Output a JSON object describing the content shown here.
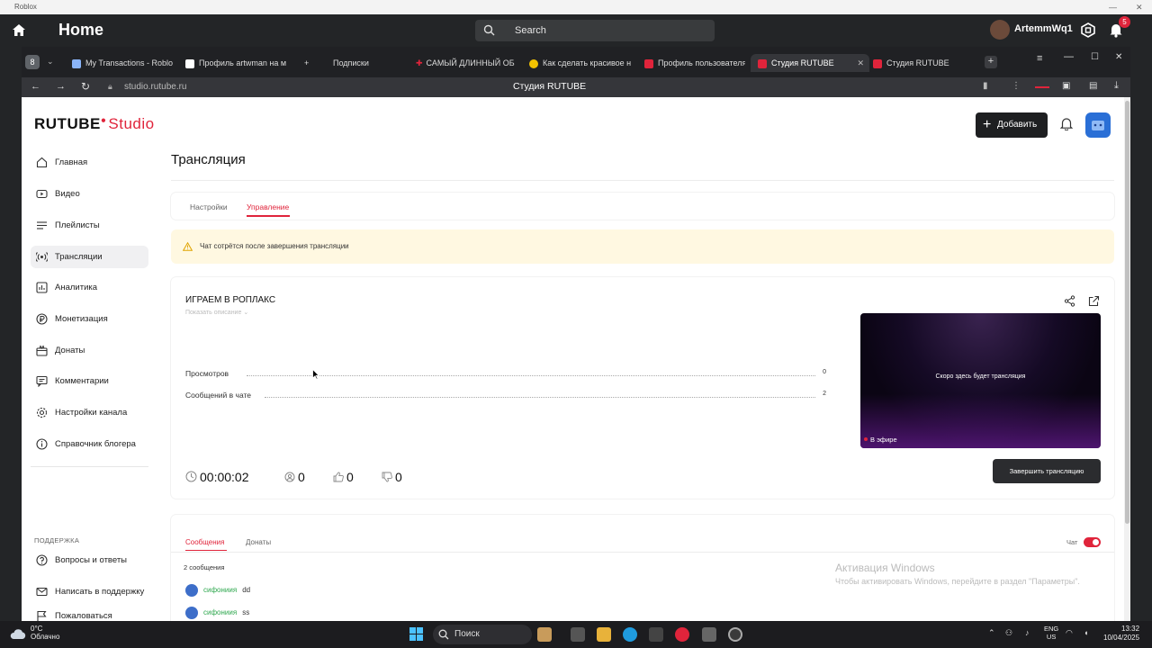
{
  "roblox": {
    "titlebar": "Roblox",
    "home_title": "Home",
    "search_placeholder": "Search",
    "username": "ArtemmWq1",
    "notification_count": "5"
  },
  "browser": {
    "tab_count": "8",
    "tabs": [
      {
        "label": "My Transactions - Roblox",
        "color": "#8ab4f8"
      },
      {
        "label": "Профиль artwman на м",
        "color": "#1f1f1f"
      },
      {
        "label": "Подписки",
        "color": "#e0243b"
      },
      {
        "label": "САМЫЙ ДЛИННЫЙ ОБ",
        "color": "#e0243b"
      },
      {
        "label": "Как сделать красивое н",
        "color": "#f2c200"
      },
      {
        "label": "Профиль пользователя",
        "color": "#e0243b"
      },
      {
        "label": "Студия RUTUBE",
        "color": "#e0243b"
      },
      {
        "label": "Студия RUTUBE",
        "color": "#e0243b"
      }
    ],
    "url": "studio.rutube.ru",
    "page_title": "Студия RUTUBE"
  },
  "studio": {
    "logo_main": "RUTUBE",
    "logo_studio": "Studio",
    "add_label": "Добавить",
    "nav": [
      {
        "label": "Главная",
        "icon": "home-icon"
      },
      {
        "label": "Видео",
        "icon": "video-icon"
      },
      {
        "label": "Плейлисты",
        "icon": "playlist-icon"
      },
      {
        "label": "Трансляции",
        "icon": "broadcast-icon"
      },
      {
        "label": "Аналитика",
        "icon": "analytics-icon"
      },
      {
        "label": "Монетизация",
        "icon": "ruble-icon"
      },
      {
        "label": "Донаты",
        "icon": "gift-icon"
      },
      {
        "label": "Комментарии",
        "icon": "comment-icon"
      },
      {
        "label": "Настройки канала",
        "icon": "gear-icon"
      },
      {
        "label": "Справочник блогера",
        "icon": "info-icon"
      }
    ],
    "support_heading": "ПОДДЕРЖКА",
    "support": [
      {
        "label": "Вопросы и ответы",
        "icon": "help-icon"
      },
      {
        "label": "Написать в поддержку",
        "icon": "mail-icon"
      },
      {
        "label": "Пожаловаться",
        "icon": "flag-icon"
      }
    ],
    "page_title": "Трансляция",
    "tabs": {
      "settings": "Настройки",
      "manage": "Управление"
    },
    "warning": "Чат сотрётся после завершения трансляции",
    "stream": {
      "title": "ИГРАЕМ В РОПЛАКС",
      "show_description": "Показать описание",
      "views_label": "Просмотров",
      "views_value": "0",
      "messages_label": "Сообщений в чате",
      "messages_value": "2",
      "timer": "00:00:02",
      "viewers": "0",
      "likes": "0",
      "dislikes": "0",
      "preview_text": "Скоро здесь будет трансляция",
      "on_air": "В эфире",
      "end_button": "Завершить трансляцию"
    },
    "chat": {
      "tab_messages": "Сообщения",
      "tab_donations": "Донаты",
      "chat_label": "Чат",
      "count": "2 сообщения",
      "messages": [
        {
          "nick": "сифониия",
          "text": "dd"
        },
        {
          "nick": "сифониия",
          "text": "ss"
        }
      ]
    },
    "watermark": {
      "line1": "Активация Windows",
      "line2": "Чтобы активировать Windows, перейдите в раздел \"Параметры\"."
    }
  },
  "taskbar": {
    "temp": "0°C",
    "weather": "Облачно",
    "search": "Поиск",
    "lang1": "ENG",
    "lang2": "US",
    "time": "13:32",
    "date": "10/04/2025"
  },
  "colors": {
    "accent": "#e0243b",
    "dark": "#1e1f21",
    "warning_bg": "#fff8e1"
  }
}
